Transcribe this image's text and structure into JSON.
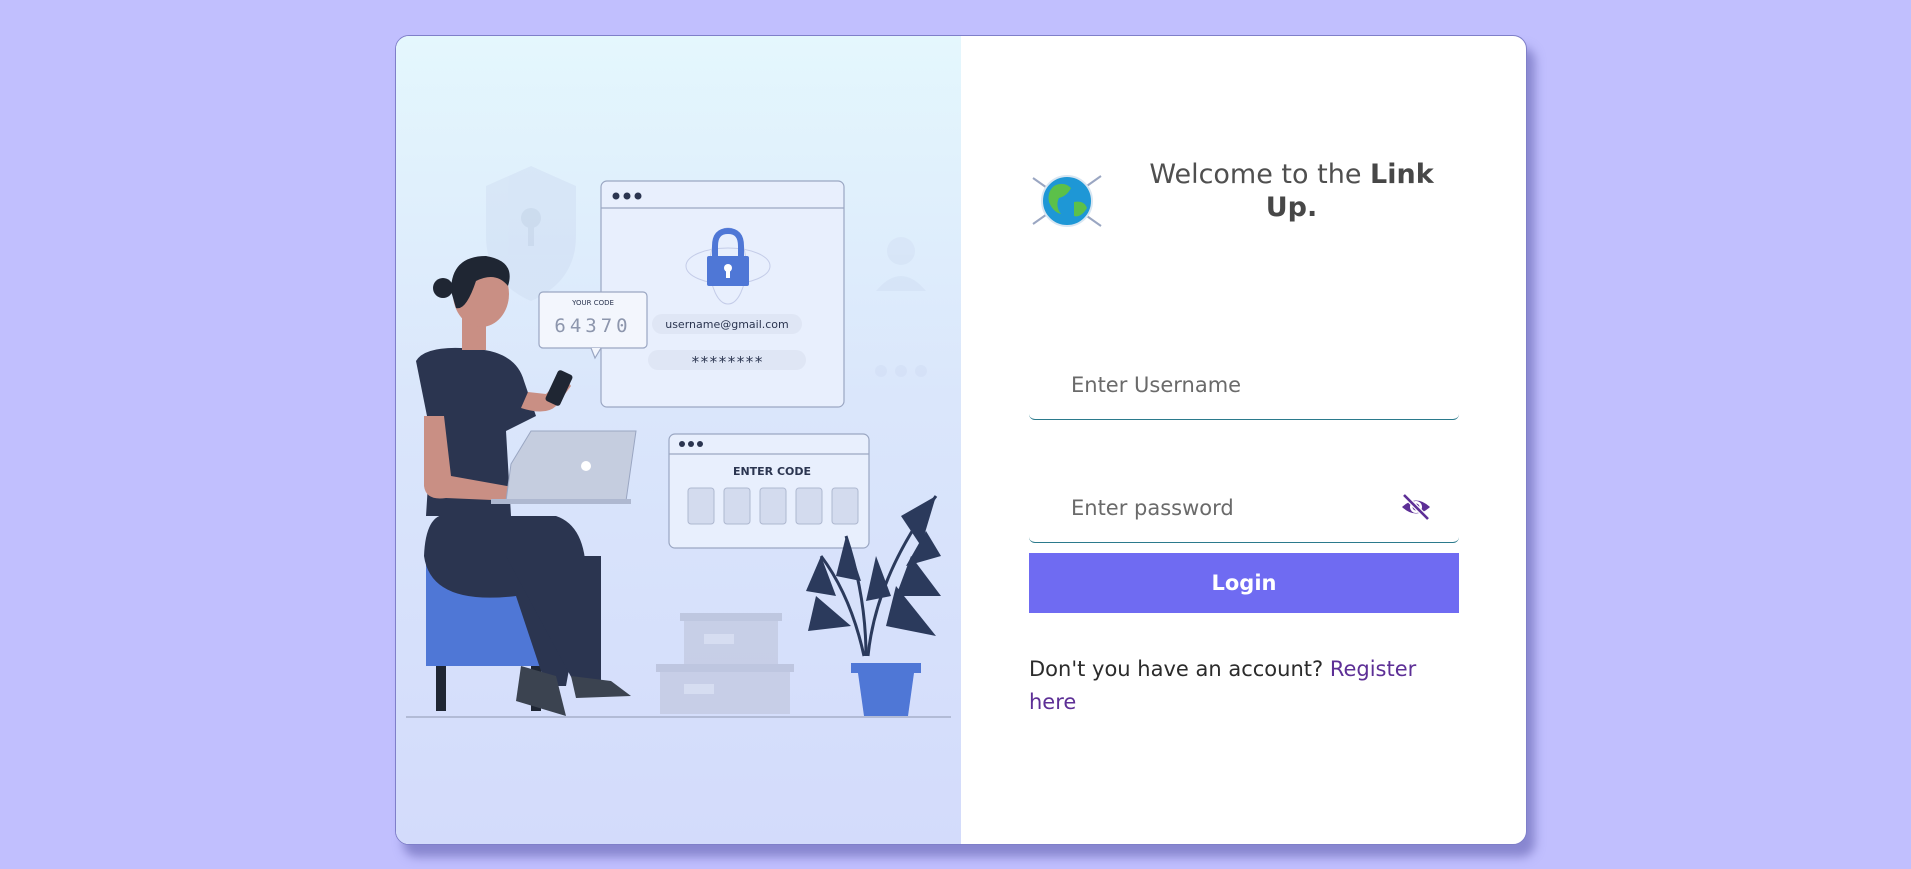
{
  "illustration": {
    "your_code_label": "YOUR CODE",
    "your_code_value": "64370",
    "email_text": "username@gmail.com",
    "password_mask": "********",
    "enter_code_label": "ENTER CODE"
  },
  "header": {
    "welcome_prefix": "Welcome to the ",
    "brand_name": "Link Up."
  },
  "form": {
    "username_placeholder": "Enter Username",
    "username_value": "",
    "password_placeholder": "Enter password",
    "password_value": "",
    "login_label": "Login"
  },
  "footer": {
    "register_prompt": "Don't you have an account? ",
    "register_link": "Register here"
  },
  "colors": {
    "background": "#c1bffe",
    "accent": "#6f6bf2",
    "link": "#5d2f96",
    "field_underline": "#2b7a8c"
  }
}
